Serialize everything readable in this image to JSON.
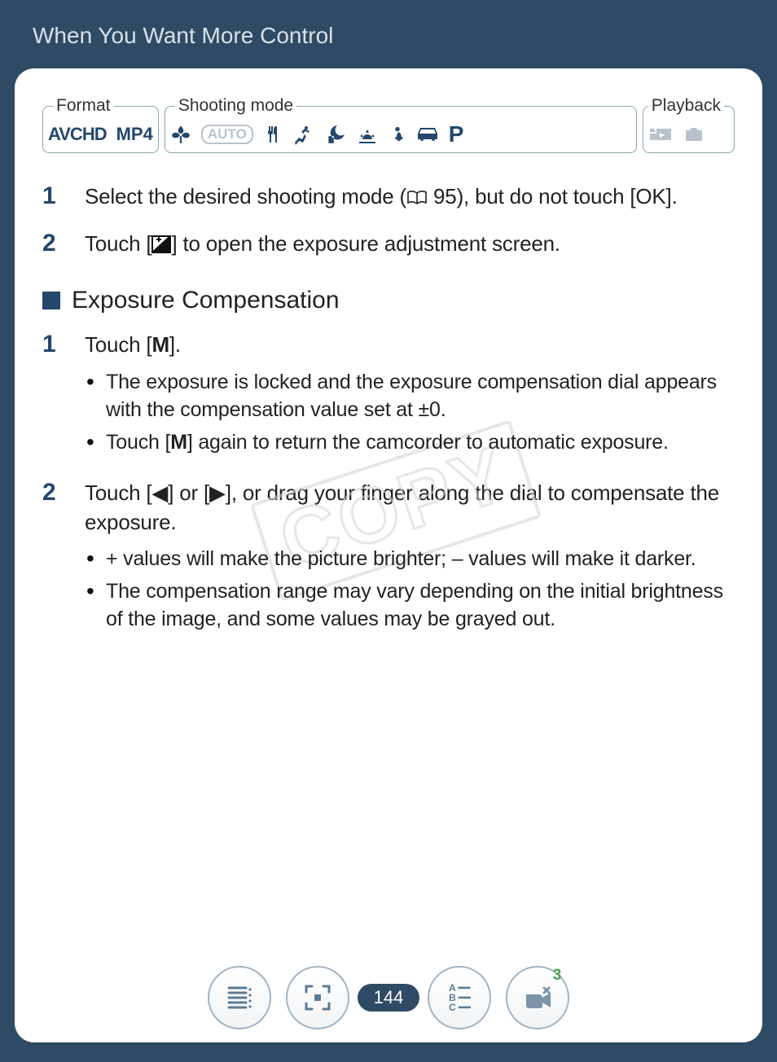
{
  "header": {
    "title": "When You Want More Control"
  },
  "modebar": {
    "format": {
      "legend": "Format",
      "items": [
        "AVCHD",
        "MP4"
      ]
    },
    "shooting": {
      "legend": "Shooting mode",
      "items": [
        "macro",
        "auto",
        "food",
        "sports",
        "night",
        "sunset",
        "snow",
        "car",
        "program"
      ],
      "auto_label": "AUTO",
      "p_label": "P"
    },
    "playback": {
      "legend": "Playback",
      "items": [
        "video-play",
        "photo-play"
      ]
    }
  },
  "steps_intro": [
    {
      "num": "1",
      "text_before": "Select the desired shooting mode (",
      "page_ref": "95",
      "text_after": "), but do not touch [OK]."
    },
    {
      "num": "2",
      "text_before": "Touch [",
      "text_after": "] to open the exposure adjustment screen."
    }
  ],
  "section": {
    "title": "Exposure Compensation"
  },
  "steps_exp": [
    {
      "num": "1",
      "main_before": "Touch [",
      "main_bold": "M",
      "main_after": "].",
      "bullets": [
        "The exposure is locked and the exposure compensation dial appears with the compensation value set at ±0.",
        {
          "before": "Touch [",
          "bold": "M",
          "after": "] again to return the camcorder to automatic exposure."
        }
      ]
    },
    {
      "num": "2",
      "main": "Touch [◀] or [▶], or drag your finger along the dial to compensate the exposure.",
      "bullets": [
        "+ values will make the picture brighter; – values will make it darker.",
        "The compensation range may vary depending on the initial brightness of the image, and some values may be grayed out."
      ]
    }
  ],
  "watermark": "COPY",
  "footer": {
    "page_number": "144",
    "badge": "3",
    "abc": {
      "a": "A",
      "b": "B",
      "c": "C"
    }
  }
}
